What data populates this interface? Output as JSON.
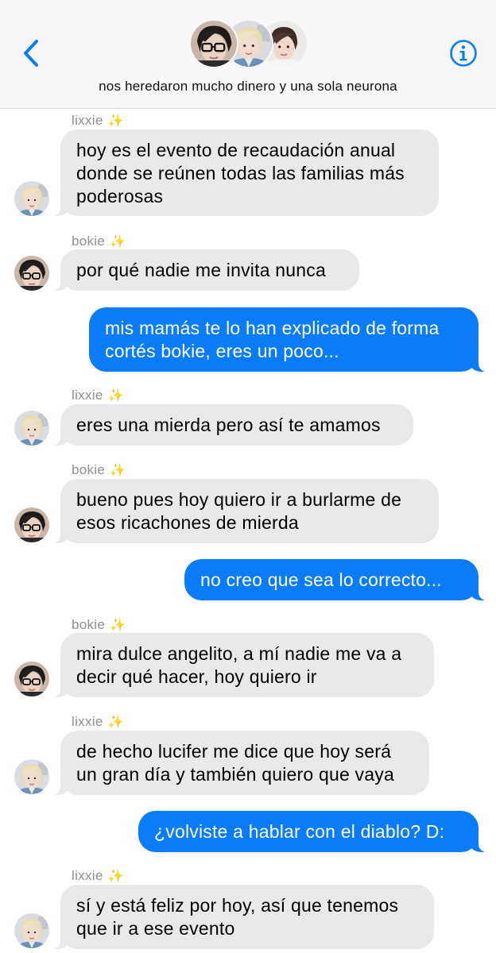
{
  "header": {
    "group_name": "nos heredaron mucho dinero y una sola neurona",
    "back_icon": "chevron-left-icon",
    "info_icon": "info-circle-icon",
    "accent_color": "#0a7cf7"
  },
  "messages": [
    {
      "sender": "lixxie",
      "emoji": "✨",
      "text": "hoy es el evento de recaudación anual donde se reúnen todas las familias más poderosas"
    },
    {
      "sender": "bokie",
      "emoji": "✨",
      "text": "por qué nadie me invita nunca"
    },
    {
      "text": "mis mamás te lo han explicado de forma cortés bokie, eres un poco..."
    },
    {
      "sender": "lixxie",
      "emoji": "✨",
      "text": "eres una mierda pero así te amamos"
    },
    {
      "sender": "bokie",
      "emoji": "✨",
      "text": "bueno pues hoy quiero ir a burlarme de esos ricachones de mierda"
    },
    {
      "text": "no creo que sea lo correcto..."
    },
    {
      "sender": "bokie",
      "emoji": "✨",
      "text": "mira dulce angelito, a mí nadie me va a decir qué hacer, hoy quiero ir"
    },
    {
      "sender": "lixxie",
      "emoji": "✨",
      "text": "de hecho lucifer me dice que hoy será un gran día y también quiero que vaya"
    },
    {
      "text": "¿volviste a hablar con el diablo? D:"
    },
    {
      "sender": "lixxie",
      "emoji": "✨",
      "text": "sí y está feliz por hoy, así que tenemos que ir a ese evento"
    }
  ]
}
